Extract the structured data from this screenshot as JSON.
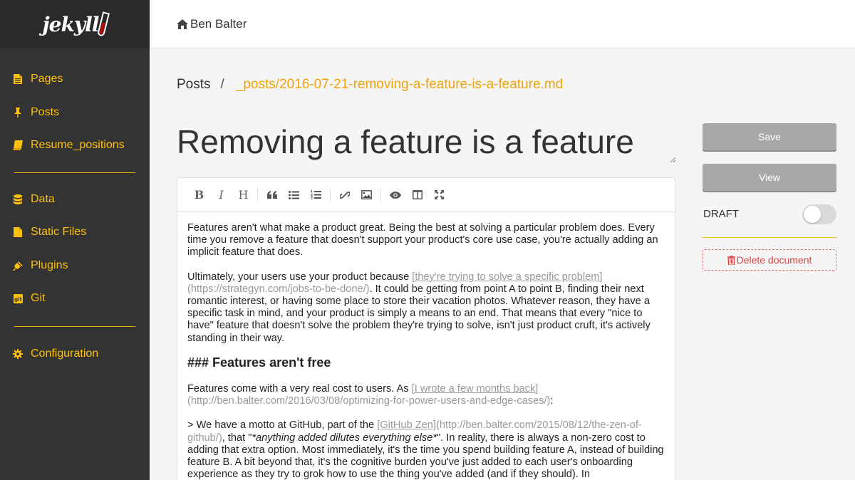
{
  "app": {
    "logo_text": "jekyll"
  },
  "topbar": {
    "site_name": "Ben Balter"
  },
  "sidebar": {
    "items": [
      {
        "label": "Pages",
        "icon": "file-icon"
      },
      {
        "label": "Posts",
        "icon": "thumbtack-icon"
      },
      {
        "label": "Resume_positions",
        "icon": "book-icon"
      },
      {
        "label": "Data",
        "icon": "database-icon"
      },
      {
        "label": "Static Files",
        "icon": "file-icon"
      },
      {
        "label": "Plugins",
        "icon": "plug-icon"
      },
      {
        "label": "Git",
        "icon": "git-icon"
      },
      {
        "label": "Configuration",
        "icon": "gear-icon"
      }
    ],
    "accent_color": "#ffc107"
  },
  "breadcrumb": {
    "section": "Posts",
    "separator": "/",
    "path": "_posts/2016-07-21-removing-a-feature-is-a-feature.md"
  },
  "document": {
    "title": "Removing a feature is a feature"
  },
  "editor": {
    "toolbar": [
      "bold",
      "italic",
      "heading",
      "quote",
      "unordered-list",
      "ordered-list",
      "link",
      "image",
      "preview",
      "side-by-side",
      "fullscreen"
    ],
    "toolbar_glyphs": {
      "bold": "B",
      "italic": "I",
      "heading": "H"
    },
    "p1": "Features aren't what make a product great. Being the best at solving a particular problem does. Every time you remove a feature that doesn't support your product's core use case, you're actually adding an implicit feature that does.",
    "p2_pre": "Ultimately, your users use your product because ",
    "p2_link": "[they're trying to solve a specific problem]",
    "p2_url": "(https://strategyn.com/jobs-to-be-done/)",
    "p2_post": ". It could be getting from point A to point B, finding their next romantic interest, or having some place to store their vacation photos. Whatever reason, they have a specific task in mind, and your product is simply a means to an end. That means that every \"nice to have\" feature that doesn't solve the problem they're trying to solve, isn't just product cruft, it's actively standing in their way.",
    "h3": "### Features aren't free",
    "p3_pre": "Features come with a very real cost to users. As ",
    "p3_link": "[I wrote a few months back]",
    "p3_url": "(http://ben.balter.com/2016/03/08/optimizing-for-power-users-and-edge-cases/)",
    "p3_post": ":",
    "q_pre": "> We have a motto at GitHub, part of the ",
    "q_link": "[GitHub Zen]",
    "q_url": "(http://ben.balter.com/2015/08/12/the-zen-of-github/)",
    "q_mid": ", that \"",
    "q_em": "*anything added dilutes everything else*",
    "q_post": "\". In reality, there is always a non-zero cost to adding that extra option. Most immediately, it's the time you spend building feature A, instead of building feature B. A bit beyond that, it's the cognitive burden you've just added to each user's onboarding experience as they try to grok how to use the thing you've added (and if they should). In"
  },
  "actions": {
    "save_label": "Save",
    "view_label": "View",
    "draft_label": "DRAFT",
    "draft_enabled": false,
    "delete_label": "Delete document"
  },
  "colors": {
    "sidebar_bg": "#333333",
    "accent": "#ffc107",
    "path": "#f0a30a",
    "button_bg": "#a8a8a8",
    "delete": "#dd4444"
  }
}
